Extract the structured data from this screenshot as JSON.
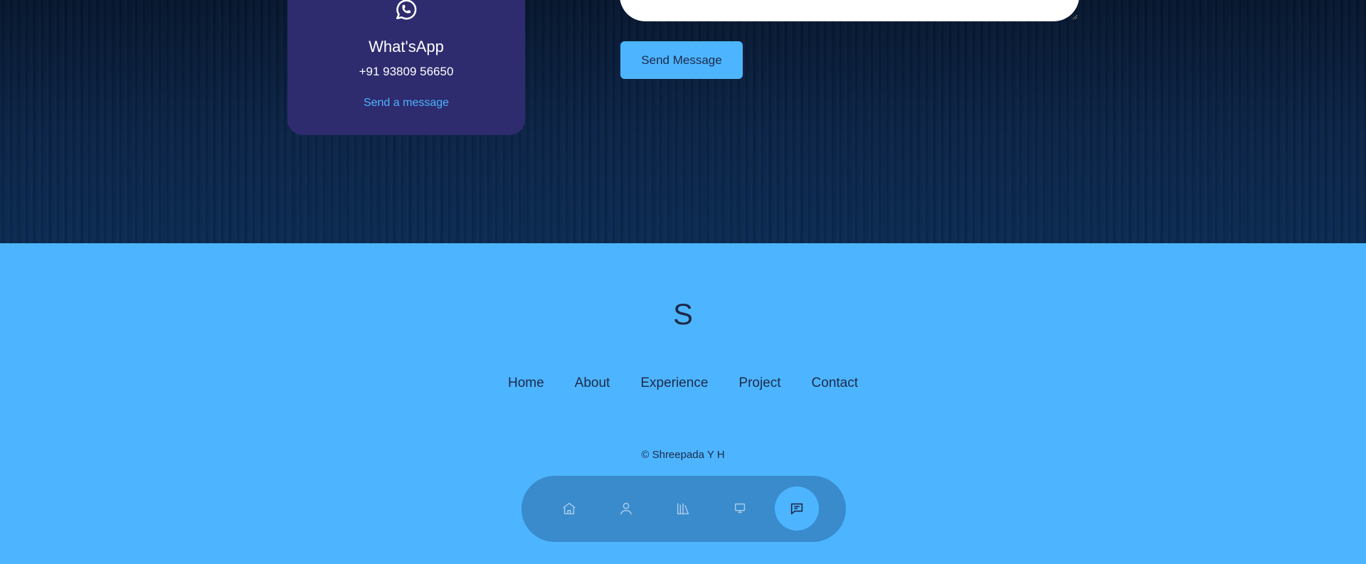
{
  "contact": {
    "whatsapp": {
      "icon": "whatsapp-icon",
      "title": "What'sApp",
      "phone": "+91 93809 56650",
      "link_label": "Send a message"
    },
    "form": {
      "send_label": "Send Message"
    }
  },
  "footer": {
    "logo": "S",
    "links": [
      "Home",
      "About",
      "Experience",
      "Project",
      "Contact"
    ],
    "copyright": "© Shreepada Y H"
  },
  "bottom_nav": {
    "items": [
      {
        "icon": "home-icon",
        "active": false
      },
      {
        "icon": "user-icon",
        "active": false
      },
      {
        "icon": "books-icon",
        "active": false
      },
      {
        "icon": "monitor-icon",
        "active": false
      },
      {
        "icon": "message-icon",
        "active": true
      }
    ]
  },
  "colors": {
    "accent": "#4db5ff",
    "card": "#2e2b6f",
    "dark_text": "#1d2a4a",
    "background_top": "#0a1a33"
  }
}
